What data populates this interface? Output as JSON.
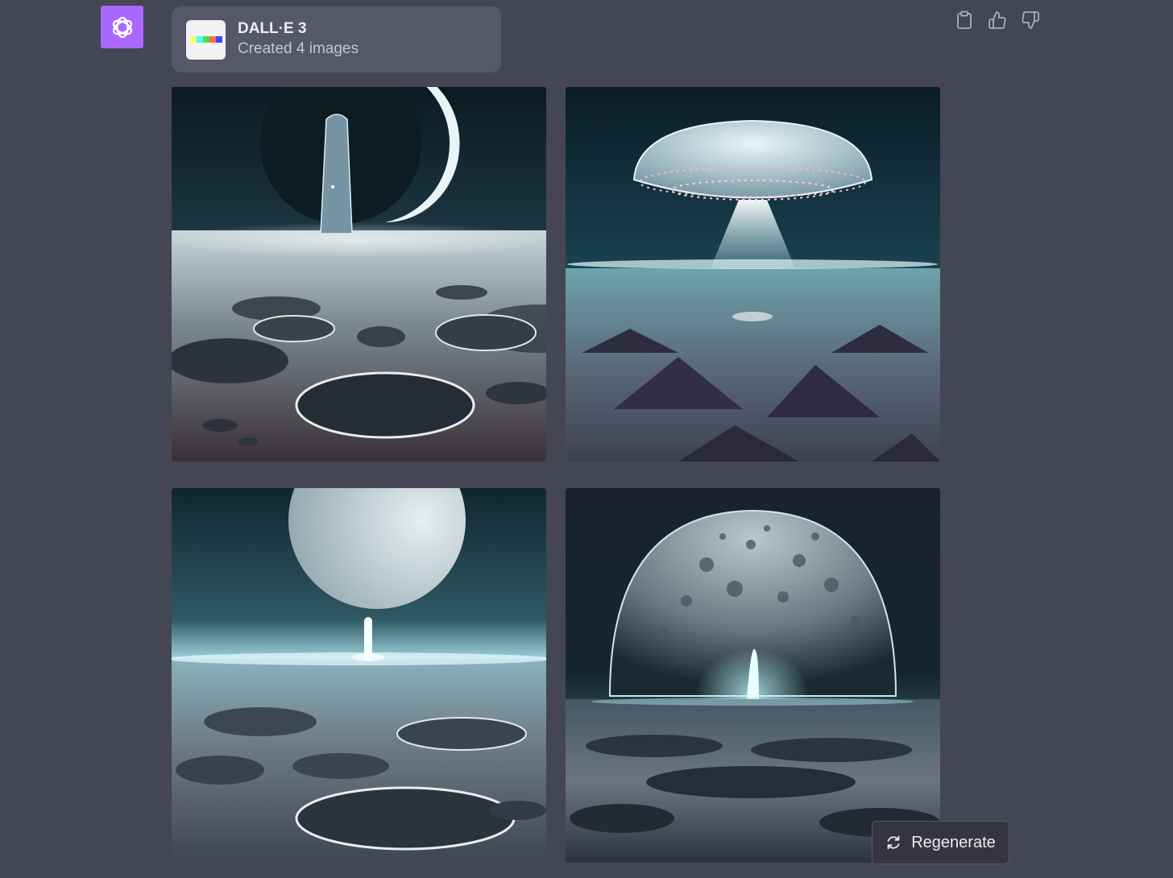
{
  "message": {
    "avatar_icon": "openai-logo-icon",
    "avatar_color": "#ab68ff",
    "tool": {
      "logo_icon": "dalle-color-bar-icon",
      "title": "DALL·E 3",
      "subtitle": "Created 4 images"
    },
    "actions": [
      {
        "icon": "clipboard-icon"
      },
      {
        "icon": "thumbs-up-icon"
      },
      {
        "icon": "thumbs-down-icon"
      }
    ],
    "images": [
      {
        "subject": "monolith-crescent-planet-craters"
      },
      {
        "subject": "ufo-beam-over-lunar-plain"
      },
      {
        "subject": "moon-glowing-pillar-craters"
      },
      {
        "subject": "cratered-planet-dome-glowing-spire"
      }
    ]
  },
  "regenerate": {
    "icon": "refresh-icon",
    "label": "Regenerate"
  },
  "colors": {
    "background": "#444654",
    "card": "#565869",
    "button": "#343541",
    "text": "#ececf1",
    "muted": "#c5c5d2"
  }
}
